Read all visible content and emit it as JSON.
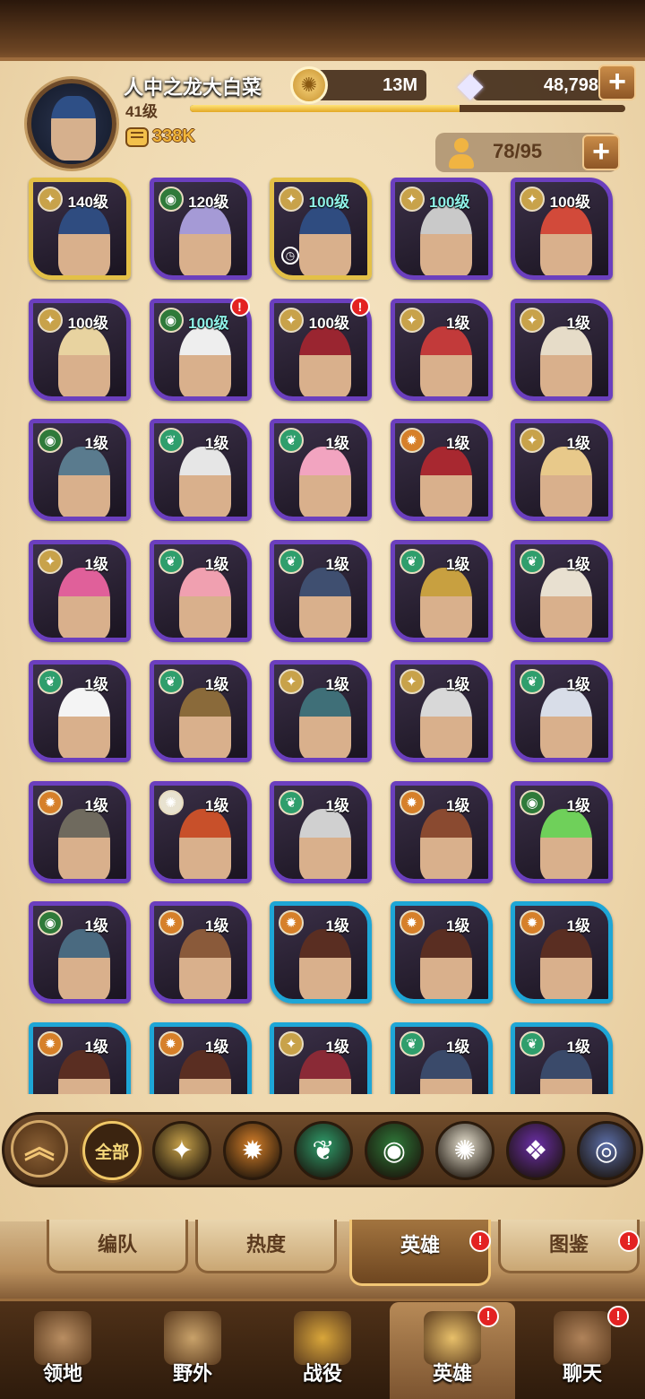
{
  "player": {
    "name": "人中之龙大白菜",
    "level": "41级",
    "xp_fraction": 0.62,
    "power": "338K",
    "avatar_icon": "hero-portrait"
  },
  "resources": {
    "gold": "13M",
    "gems": "48,798",
    "plus": "+",
    "gold_icon": "gold-coin-icon",
    "gem_icon": "diamond-icon"
  },
  "roster": {
    "count": "78/95",
    "plus": "+"
  },
  "colors": {
    "lightbearer": "#c8a24a",
    "mauler": "#d6802a",
    "wilder": "#2f9e6c",
    "graveborn": "#2f7a3a",
    "celestial": "#e8e2d0",
    "hypogean": "#6b2fa8",
    "dimensional": "#5b6ea8",
    "frame_purple": "#6b3fbe",
    "frame_gold": "#e3c047",
    "frame_blue": "#1ea6d6",
    "badge_red": "#e32222"
  },
  "heroes": [
    {
      "level": "140级",
      "faction": "lightbearer",
      "frame": "gold",
      "alert": false,
      "timer": false,
      "tone": "#2f4c80"
    },
    {
      "level": "120级",
      "faction": "graveborn",
      "frame": "purple",
      "alert": false,
      "timer": false,
      "tone": "#a59ad6"
    },
    {
      "level": "100级",
      "faction": "lightbearer",
      "frame": "gold",
      "alert": false,
      "timer": true,
      "tone": "#2f4c80",
      "teal": true
    },
    {
      "level": "100级",
      "faction": "lightbearer",
      "frame": "purple",
      "alert": false,
      "timer": false,
      "tone": "#c9c9c9",
      "teal": true
    },
    {
      "level": "100级",
      "faction": "lightbearer",
      "frame": "purple",
      "alert": false,
      "timer": false,
      "tone": "#d24a3a"
    },
    {
      "level": "100级",
      "faction": "lightbearer",
      "frame": "purple",
      "alert": false,
      "timer": false,
      "tone": "#e8d3a0"
    },
    {
      "level": "100级",
      "faction": "graveborn",
      "frame": "purple",
      "alert": true,
      "timer": false,
      "tone": "#eeeeee",
      "teal": true
    },
    {
      "level": "100级",
      "faction": "lightbearer",
      "frame": "purple",
      "alert": true,
      "timer": false,
      "tone": "#9a2530"
    },
    {
      "level": "1级",
      "faction": "lightbearer",
      "frame": "purple",
      "alert": false,
      "timer": false,
      "tone": "#c23a3a"
    },
    {
      "level": "1级",
      "faction": "lightbearer",
      "frame": "purple",
      "alert": false,
      "timer": false,
      "tone": "#e6dcc8"
    },
    {
      "level": "1级",
      "faction": "graveborn",
      "frame": "purple",
      "alert": false,
      "timer": false,
      "tone": "#5a7b8e"
    },
    {
      "level": "1级",
      "faction": "wilder",
      "frame": "purple",
      "alert": false,
      "timer": false,
      "tone": "#e6e6e6"
    },
    {
      "level": "1级",
      "faction": "wilder",
      "frame": "purple",
      "alert": false,
      "timer": false,
      "tone": "#f2a4c0"
    },
    {
      "level": "1级",
      "faction": "mauler",
      "frame": "purple",
      "alert": false,
      "timer": false,
      "tone": "#a82830"
    },
    {
      "level": "1级",
      "faction": "lightbearer",
      "frame": "purple",
      "alert": false,
      "timer": false,
      "tone": "#e8c98a"
    },
    {
      "level": "1级",
      "faction": "lightbearer",
      "frame": "purple",
      "alert": false,
      "timer": false,
      "tone": "#e0609a"
    },
    {
      "level": "1级",
      "faction": "wilder",
      "frame": "purple",
      "alert": false,
      "timer": false,
      "tone": "#f0a0b0"
    },
    {
      "level": "1级",
      "faction": "wilder",
      "frame": "purple",
      "alert": false,
      "timer": false,
      "tone": "#3f4f70"
    },
    {
      "level": "1级",
      "faction": "wilder",
      "frame": "purple",
      "alert": false,
      "timer": false,
      "tone": "#c8a040"
    },
    {
      "level": "1级",
      "faction": "wilder",
      "frame": "purple",
      "alert": false,
      "timer": false,
      "tone": "#e8e0d0"
    },
    {
      "level": "1级",
      "faction": "wilder",
      "frame": "purple",
      "alert": false,
      "timer": false,
      "tone": "#f4f4f4"
    },
    {
      "level": "1级",
      "faction": "wilder",
      "frame": "purple",
      "alert": false,
      "timer": false,
      "tone": "#8a6a3a"
    },
    {
      "level": "1级",
      "faction": "lightbearer",
      "frame": "purple",
      "alert": false,
      "timer": false,
      "tone": "#3f6f78"
    },
    {
      "level": "1级",
      "faction": "lightbearer",
      "frame": "purple",
      "alert": false,
      "timer": false,
      "tone": "#d8d8d8"
    },
    {
      "level": "1级",
      "faction": "wilder",
      "frame": "purple",
      "alert": false,
      "timer": false,
      "tone": "#d8dde8"
    },
    {
      "level": "1级",
      "faction": "mauler",
      "frame": "purple",
      "alert": false,
      "timer": false,
      "tone": "#6f6a5e"
    },
    {
      "level": "1级",
      "faction": "celestial",
      "frame": "purple",
      "alert": false,
      "timer": false,
      "tone": "#c8502a"
    },
    {
      "level": "1级",
      "faction": "wilder",
      "frame": "purple",
      "alert": false,
      "timer": false,
      "tone": "#d0d0d0"
    },
    {
      "level": "1级",
      "faction": "mauler",
      "frame": "purple",
      "alert": false,
      "timer": false,
      "tone": "#8a4a30"
    },
    {
      "level": "1级",
      "faction": "graveborn",
      "frame": "purple",
      "alert": false,
      "timer": false,
      "tone": "#6fd05a"
    },
    {
      "level": "1级",
      "faction": "graveborn",
      "frame": "purple",
      "alert": false,
      "timer": false,
      "tone": "#4a6a80"
    },
    {
      "level": "1级",
      "faction": "mauler",
      "frame": "purple",
      "alert": false,
      "timer": false,
      "tone": "#8a5a3a"
    },
    {
      "level": "1级",
      "faction": "mauler",
      "frame": "blue",
      "alert": false,
      "timer": false,
      "tone": "#5a2e22"
    },
    {
      "level": "1级",
      "faction": "mauler",
      "frame": "blue",
      "alert": false,
      "timer": false,
      "tone": "#5a2e22"
    },
    {
      "level": "1级",
      "faction": "mauler",
      "frame": "blue",
      "alert": false,
      "timer": false,
      "tone": "#5a2e22"
    },
    {
      "level": "1级",
      "faction": "mauler",
      "frame": "blue",
      "alert": false,
      "timer": false,
      "tone": "#5a2e22"
    },
    {
      "level": "1级",
      "faction": "mauler",
      "frame": "blue",
      "alert": false,
      "timer": false,
      "tone": "#5a2e22"
    },
    {
      "level": "1级",
      "faction": "lightbearer",
      "frame": "blue",
      "alert": false,
      "timer": false,
      "tone": "#8a2a36"
    },
    {
      "level": "1级",
      "faction": "wilder",
      "frame": "blue",
      "alert": false,
      "timer": false,
      "tone": "#3a4a6a"
    },
    {
      "level": "1级",
      "faction": "wilder",
      "frame": "blue",
      "alert": false,
      "timer": false,
      "tone": "#3a4a6a"
    }
  ],
  "filters": {
    "collapse_icon": "double-chevron-up-icon",
    "all_label": "全部",
    "chips": [
      "lightbearer",
      "mauler",
      "wilder",
      "graveborn",
      "celestial",
      "hypogean",
      "dimensional"
    ]
  },
  "subtabs": [
    {
      "label": "编队",
      "active": false,
      "badge": false
    },
    {
      "label": "热度",
      "active": false,
      "badge": false
    },
    {
      "label": "英雄",
      "active": true,
      "badge": true
    },
    {
      "label": "图鉴",
      "active": false,
      "badge": true
    }
  ],
  "nav": [
    {
      "label": "领地",
      "icon": "castle-icon",
      "active": false,
      "badge": false
    },
    {
      "label": "野外",
      "icon": "scroll-map-icon",
      "active": false,
      "badge": false
    },
    {
      "label": "战役",
      "icon": "sword-shield-icon",
      "active": false,
      "badge": false
    },
    {
      "label": "英雄",
      "icon": "helmet-icon",
      "active": true,
      "badge": true
    },
    {
      "label": "聊天",
      "icon": "chat-bubble-icon",
      "active": false,
      "badge": true
    }
  ],
  "badge_mark": "!"
}
